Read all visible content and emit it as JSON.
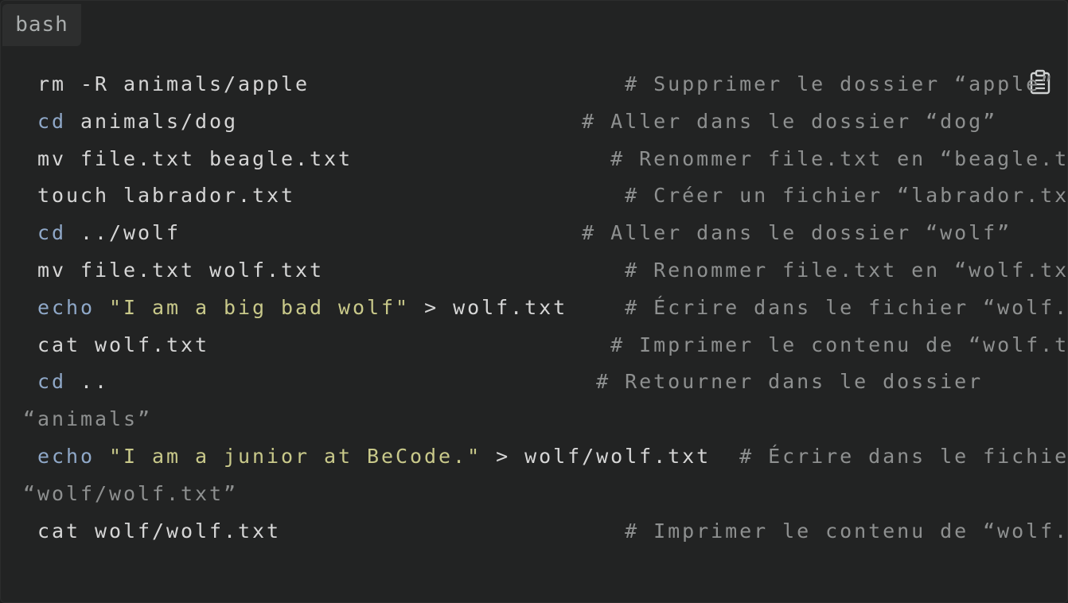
{
  "language_label": "bash",
  "copy_button": {
    "icon": "clipboard-icon"
  },
  "colors": {
    "background": "#222323",
    "keyword": "#8fa8c8",
    "string": "#c9c98a",
    "comment": "#8e9090",
    "text": "#d6d6d6"
  },
  "lines": [
    {
      "kw": "",
      "rest": " rm -R animals/apple",
      "str": "",
      "after": "",
      "pad": "                      ",
      "comment": "# Supprimer le dossier “apple”"
    },
    {
      "kw": " cd",
      "rest": " animals/dog",
      "str": "",
      "after": "",
      "pad": "                        ",
      "comment": "# Aller dans le dossier “dog”"
    },
    {
      "kw": "",
      "rest": " mv file.txt beagle.txt",
      "str": "",
      "after": "",
      "pad": "                  ",
      "comment": "# Renommer file.txt en “beagle.txt”"
    },
    {
      "kw": "",
      "rest": " touch labrador.txt",
      "str": "",
      "after": "",
      "pad": "                       ",
      "comment": "# Créer un fichier “labrador.txt”"
    },
    {
      "kw": " cd",
      "rest": " ../wolf",
      "str": "",
      "after": "",
      "pad": "                            ",
      "comment": "# Aller dans le dossier “wolf”"
    },
    {
      "kw": "",
      "rest": " mv file.txt wolf.txt",
      "str": "",
      "after": "",
      "pad": "                     ",
      "comment": "# Renommer file.txt en “wolf.txt”"
    },
    {
      "kw": " echo",
      "rest": " ",
      "str": "\"I am a big bad wolf\"",
      "after": " > wolf.txt",
      "pad": "    ",
      "comment": "# Écrire dans le fichier “wolf.txt”"
    },
    {
      "kw": "",
      "rest": " cat wolf.txt",
      "str": "",
      "after": "",
      "pad": "                            ",
      "comment": "# Imprimer le contenu de “wolf.txt”"
    },
    {
      "kw": " cd",
      "rest": " ..",
      "str": "",
      "after": "",
      "pad": "                                  ",
      "comment": "# Retourner dans le dossier"
    },
    {
      "kw": "",
      "rest": "",
      "str": "",
      "after": "",
      "pad": "",
      "comment": "“animals”"
    },
    {
      "kw": " echo",
      "rest": " ",
      "str": "\"I am a junior at BeCode.\"",
      "after": " > wolf/wolf.txt",
      "pad": "  ",
      "comment": "# Écrire dans le fichier"
    },
    {
      "kw": "",
      "rest": "",
      "str": "",
      "after": "",
      "pad": "",
      "comment": "“wolf/wolf.txt”"
    },
    {
      "kw": "",
      "rest": " cat wolf/wolf.txt",
      "str": "",
      "after": "",
      "pad": "                        ",
      "comment": "# Imprimer le contenu de “wolf.txt”"
    }
  ]
}
